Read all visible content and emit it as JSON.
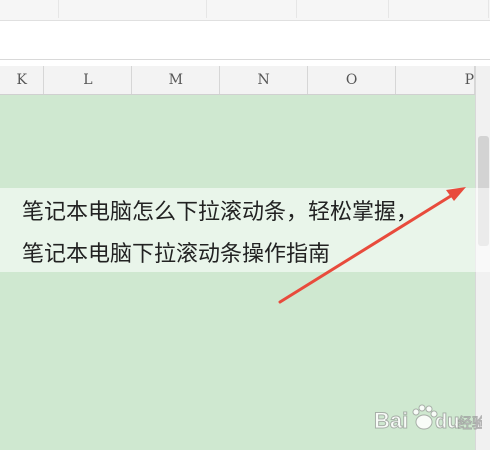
{
  "columns": [
    "K",
    "L",
    "M",
    "N",
    "O",
    "P"
  ],
  "caption": {
    "line1": "笔记本电脑怎么下拉滚动条，轻松掌握，",
    "line2": "笔记本电脑下拉滚动条操作指南"
  },
  "colors": {
    "grid_fill": "#cfe8d0",
    "arrow": "#e84b3c"
  },
  "watermark": {
    "icon": "baidu-paw-icon",
    "text": "Bai du 经验"
  }
}
